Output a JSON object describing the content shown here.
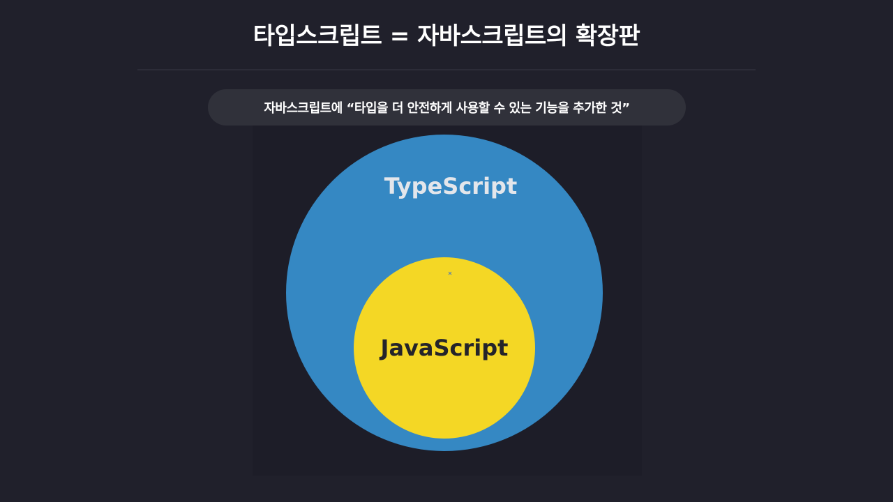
{
  "slide": {
    "title": "타입스크립트 = 자바스크립트의 확장판",
    "subtitle": "자바스크립트에 “타입을 더 안전하게 사용할 수 있는 기능을 추가한 것”"
  },
  "diagram": {
    "outer": {
      "label": "TypeScript",
      "fill": "#3588c3",
      "label_color": "#e3e6eb"
    },
    "inner": {
      "label": "JavaScript",
      "fill": "#f4d725",
      "label_color": "#24242a"
    }
  }
}
